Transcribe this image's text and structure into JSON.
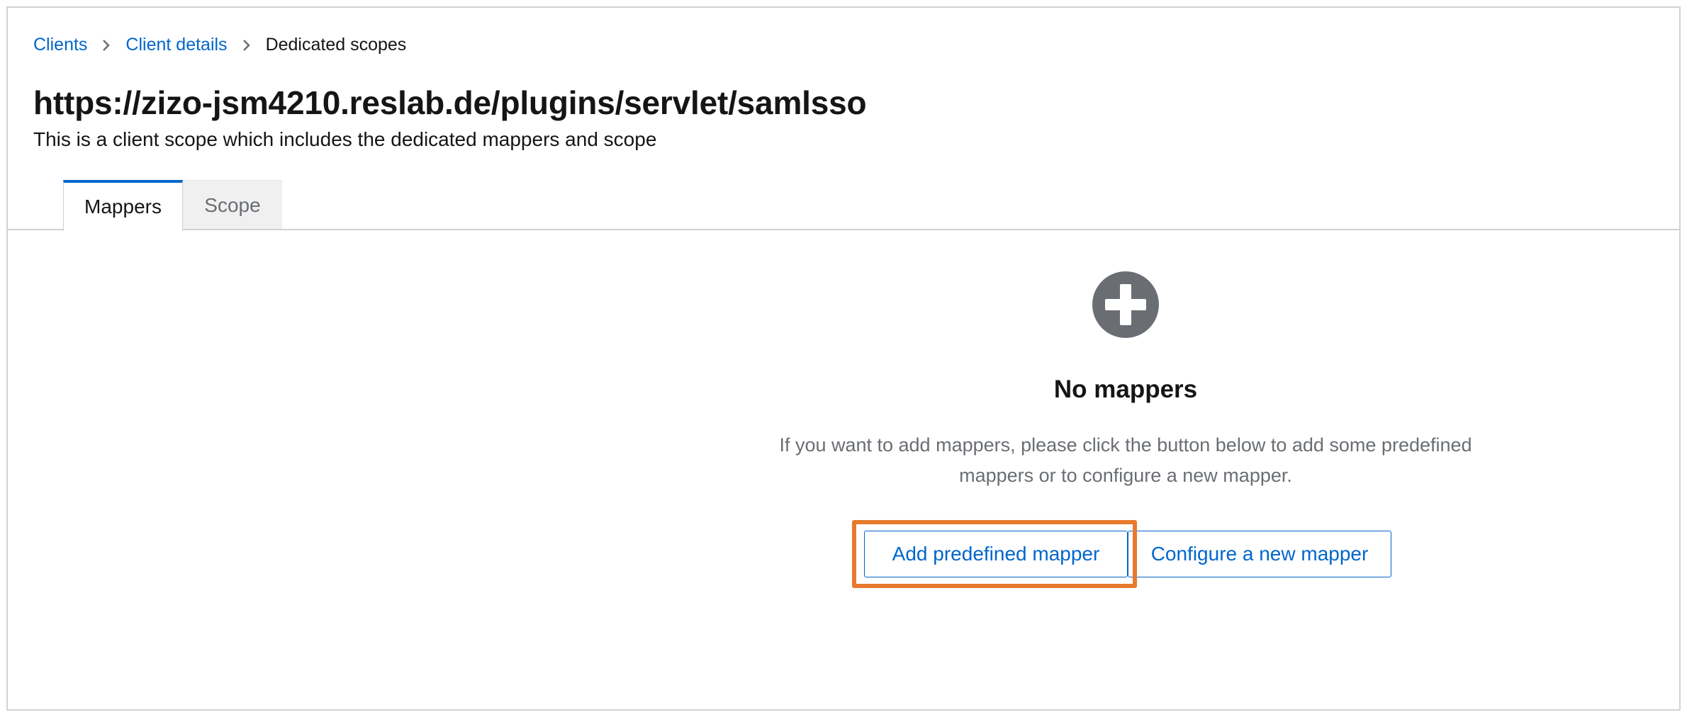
{
  "breadcrumb": {
    "items": [
      "Clients",
      "Client details"
    ],
    "current": "Dedicated scopes"
  },
  "header": {
    "title": "https://zizo-jsm4210.reslab.de/plugins/servlet/samlsso",
    "description": "This is a client scope which includes the dedicated mappers and scope"
  },
  "tabs": [
    {
      "label": "Mappers",
      "active": true
    },
    {
      "label": "Scope",
      "active": false
    }
  ],
  "empty_state": {
    "icon": "plus-circle-icon",
    "title": "No mappers",
    "body": "If you want to add mappers, please click the button below to add some predefined mappers or to configure a new mapper.",
    "primary_button": "Add predefined mapper",
    "secondary_button": "Configure a new mapper"
  },
  "colors": {
    "link": "#0066cc",
    "active_tab_border": "#0066cc",
    "highlight": "#e8792e",
    "icon": "#6a6e73"
  }
}
